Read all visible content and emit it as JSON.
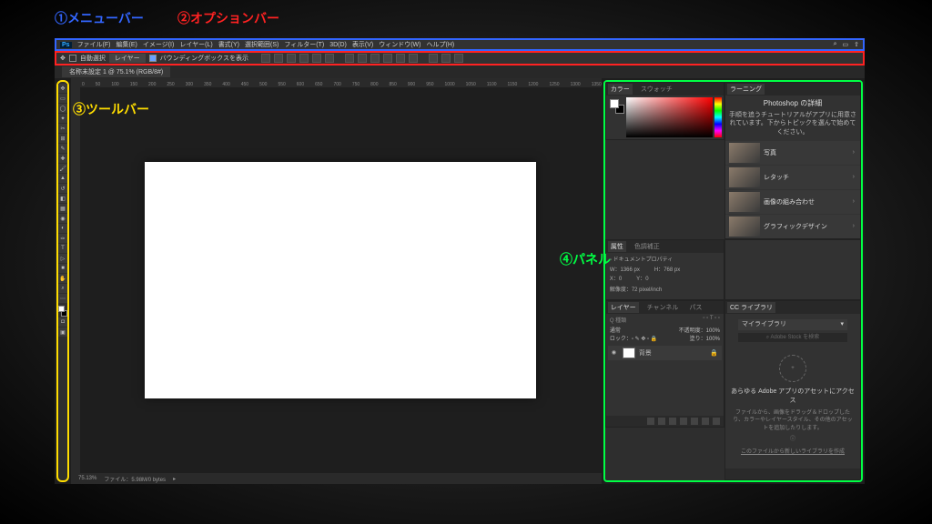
{
  "annotations": {
    "a1": "①メニューバー",
    "a2": "②オプションバー",
    "a3": "③ツールバー",
    "a4": "④パネル"
  },
  "menubar": {
    "items": [
      "ファイル(F)",
      "編集(E)",
      "イメージ(I)",
      "レイヤー(L)",
      "書式(Y)",
      "選択範囲(S)",
      "フィルター(T)",
      "3D(D)",
      "表示(V)",
      "ウィンドウ(W)",
      "ヘルプ(H)"
    ]
  },
  "options": {
    "auto_select": "自動選択",
    "layer_dropdown": "レイヤー",
    "bounding": "バウンディングボックスを表示"
  },
  "document": {
    "tab_title": "名称未設定 1 @ 75.1% (RGB/8#)",
    "zoom": "75.13%",
    "fileinfo": "ファイル：5.98M/0 bytes"
  },
  "ruler_ticks": [
    "0",
    "50",
    "100",
    "150",
    "200",
    "250",
    "300",
    "350",
    "400",
    "450",
    "500",
    "550",
    "600",
    "650",
    "700",
    "750",
    "800",
    "850",
    "900",
    "950",
    "1000",
    "1050",
    "1100",
    "1150",
    "1200",
    "1250",
    "1300",
    "1350"
  ],
  "panels": {
    "color": {
      "tabs": [
        "カラー",
        "スウォッチ"
      ]
    },
    "learn": {
      "tab": "ラーニング",
      "title": "Photoshop の詳細",
      "desc": "手順を追うチュートリアルがアプリに用意されています。下からトピックを選んで始めてください。",
      "items": [
        "写真",
        "レタッチ",
        "画像の組み合わせ",
        "グラフィックデザイン"
      ]
    },
    "props": {
      "tabs": [
        "属性",
        "色調補正"
      ],
      "doc_label": "ドキュメントプロパティ",
      "w_label": "W：",
      "w_val": "1366 px",
      "h_label": "H：",
      "h_val": "768 px",
      "x_label": "X：",
      "x_val": "0",
      "y_label": "Y：",
      "y_val": "0",
      "res_label": "解像度：",
      "res_val": "72 pixel/inch"
    },
    "layers": {
      "tabs": [
        "レイヤー",
        "チャンネル",
        "パス"
      ],
      "kind": "Q 種類",
      "blend": "通常",
      "opacity_l": "不透明度：",
      "opacity_v": "100%",
      "lock": "ロック：",
      "fill_l": "塗り：",
      "fill_v": "100%",
      "bg_layer": "背景"
    },
    "library": {
      "tab": "CC ライブラリ",
      "dropdown": "マイライブラリ",
      "search": "Adobe Stock を検索",
      "title": "あらゆる Adobe アプリのアセットにアクセス",
      "desc": "ファイルから、画像をドラッグ＆ドロップしたり、カラーやレイヤースタイル、その他のアセットを追加したりします。",
      "link": "このファイルから新しいライブラリを作成"
    }
  }
}
